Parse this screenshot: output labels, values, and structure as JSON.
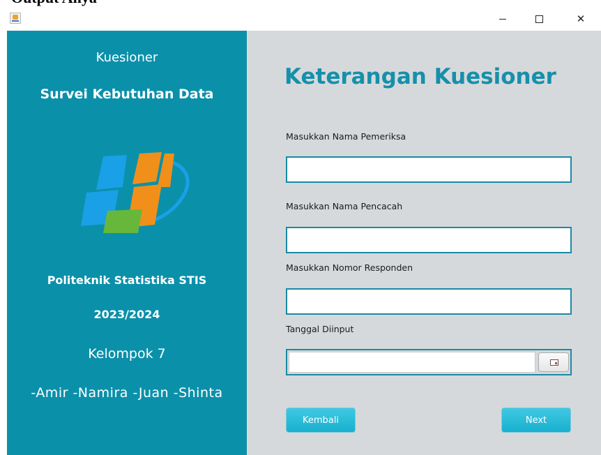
{
  "document": {
    "heading": "Output Anya"
  },
  "window": {
    "controls": {
      "minimize": "minimize",
      "maximize": "maximize",
      "close": "close"
    }
  },
  "sidebar": {
    "title": "Kuesioner",
    "survey_name": "Survei Kebutuhan Data",
    "institution": "Politeknik Statistika STIS",
    "year": "2023/2024",
    "group": "Kelompok 7",
    "members": "-Amir  -Namira  -Juan  -Shinta",
    "logo_colors": {
      "blue": "#1aa0e6",
      "orange": "#f0901a",
      "green": "#67b83a"
    }
  },
  "form": {
    "title": "Keterangan Kuesioner",
    "fields": [
      {
        "label": "Masukkan Nama Pemeriksa",
        "value": ""
      },
      {
        "label": "Masukkan Nama Pencacah",
        "value": ""
      },
      {
        "label": "Masukkan Nomor Responden",
        "value": ""
      }
    ],
    "date": {
      "label": "Tanggal Diinput",
      "value": ""
    },
    "buttons": {
      "back": "Kembali",
      "next": "Next"
    }
  },
  "colors": {
    "sidebar_bg": "#0b90aa",
    "accent": "#1690aa",
    "button": "#23b9d6",
    "main_bg": "#d6d9dc"
  }
}
